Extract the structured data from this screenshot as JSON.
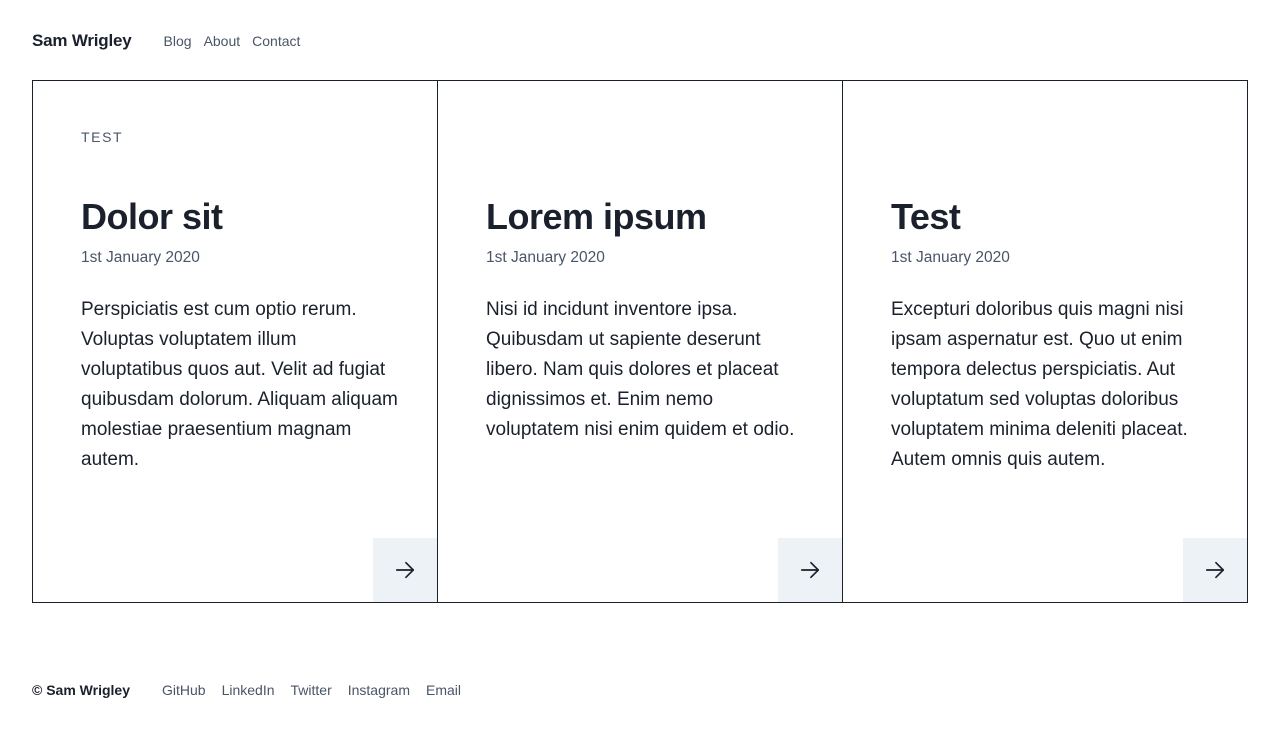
{
  "header": {
    "brand": "Sam Wrigley",
    "nav": [
      "Blog",
      "About",
      "Contact"
    ]
  },
  "cards": [
    {
      "tag": "TEST",
      "title": "Dolor sit",
      "date": "1st January 2020",
      "body": "Perspiciatis est cum optio rerum. Voluptas voluptatem illum voluptatibus quos aut. Velit ad fugiat quibusdam dolorum. Aliquam aliquam molestiae praesentium magnam autem.",
      "arrow_icon": "arrow-right-icon"
    },
    {
      "tag": "",
      "title": "Lorem ipsum",
      "date": "1st January 2020",
      "body": "Nisi id incidunt inventore ipsa. Quibusdam ut sapiente deserunt libero. Nam quis dolores et placeat dignissimos et. Enim nemo voluptatem nisi enim quidem et odio.",
      "arrow_icon": "arrow-right-icon"
    },
    {
      "tag": "",
      "title": "Test",
      "date": "1st January 2020",
      "body": "Excepturi doloribus quis magni nisi ipsam aspernatur est. Quo ut enim tempora delectus perspiciatis. Aut voluptatum sed voluptas doloribus voluptatem minima deleniti placeat. Autem omnis quis autem.",
      "arrow_icon": "arrow-right-icon"
    }
  ],
  "footer": {
    "copyright": "© Sam Wrigley",
    "links": [
      "GitHub",
      "LinkedIn",
      "Twitter",
      "Instagram",
      "Email"
    ]
  },
  "colors": {
    "text": "#1a202c",
    "muted": "#4a5568",
    "arrow_bg": "#edf2f7",
    "border": "#1a202c"
  }
}
